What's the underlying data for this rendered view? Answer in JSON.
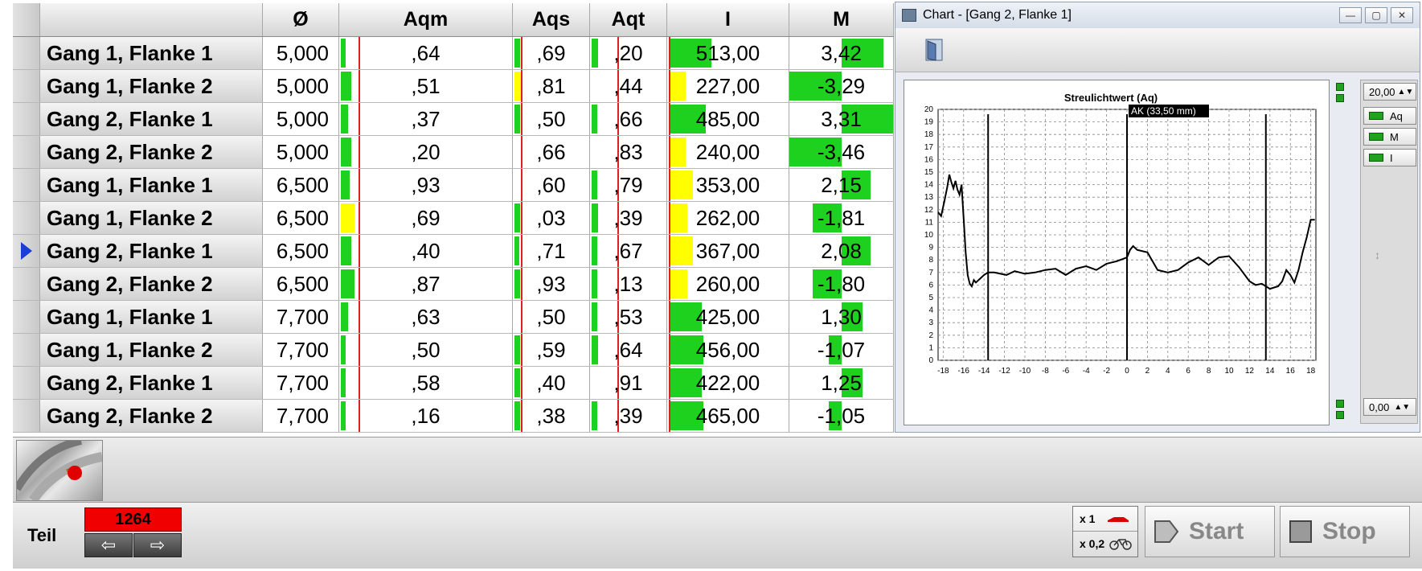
{
  "grid": {
    "headers": [
      "",
      "",
      "Ø",
      "Aqm",
      "Aqs",
      "Aqt",
      "I",
      "M"
    ],
    "rows": [
      {
        "name": "Gang 1, Flanke 1",
        "dia": "5,000",
        "aqm": ",64",
        "aqs": ",69",
        "aqt": ",20",
        "i": "513,00",
        "m": "3,42",
        "selected": false
      },
      {
        "name": "Gang 1, Flanke 2",
        "dia": "5,000",
        "aqm": ",51",
        "aqs": ",81",
        "aqt": ",44",
        "i": "227,00",
        "m": "-3,29",
        "selected": false
      },
      {
        "name": "Gang 2, Flanke 1",
        "dia": "5,000",
        "aqm": ",37",
        "aqs": ",50",
        "aqt": ",66",
        "i": "485,00",
        "m": "3,31",
        "selected": false
      },
      {
        "name": "Gang 2, Flanke 2",
        "dia": "5,000",
        "aqm": ",20",
        "aqs": ",66",
        "aqt": ",83",
        "i": "240,00",
        "m": "-3,46",
        "selected": false
      },
      {
        "name": "Gang 1, Flanke 1",
        "dia": "6,500",
        "aqm": ",93",
        "aqs": ",60",
        "aqt": ",79",
        "i": "353,00",
        "m": "2,15",
        "selected": false
      },
      {
        "name": "Gang 1, Flanke 2",
        "dia": "6,500",
        "aqm": ",69",
        "aqs": ",03",
        "aqt": ",39",
        "i": "262,00",
        "m": "-1,81",
        "selected": false
      },
      {
        "name": "Gang 2, Flanke 1",
        "dia": "6,500",
        "aqm": ",40",
        "aqs": ",71",
        "aqt": ",67",
        "i": "367,00",
        "m": "2,08",
        "selected": true
      },
      {
        "name": "Gang 2, Flanke 2",
        "dia": "6,500",
        "aqm": ",87",
        "aqs": ",93",
        "aqt": ",13",
        "i": "260,00",
        "m": "-1,80",
        "selected": false
      },
      {
        "name": "Gang 1, Flanke 1",
        "dia": "7,700",
        "aqm": ",63",
        "aqs": ",50",
        "aqt": ",53",
        "i": "425,00",
        "m": "1,30",
        "selected": false
      },
      {
        "name": "Gang 1, Flanke 2",
        "dia": "7,700",
        "aqm": ",50",
        "aqs": ",59",
        "aqt": ",64",
        "i": "456,00",
        "m": "-1,07",
        "selected": false
      },
      {
        "name": "Gang 2, Flanke 1",
        "dia": "7,700",
        "aqm": ",58",
        "aqs": ",40",
        "aqt": ",91",
        "i": "422,00",
        "m": "1,25",
        "selected": false
      },
      {
        "name": "Gang 2, Flanke 2",
        "dia": "7,700",
        "aqm": ",16",
        "aqs": ",38",
        "aqt": ",39",
        "i": "465,00",
        "m": "-1,05",
        "selected": false
      }
    ],
    "bar_levels": [
      {
        "aqm": 0.03,
        "aqs": 0.07,
        "aqt": 0.08,
        "i": 0.35,
        "m": 0.4,
        "i_color": "green"
      },
      {
        "aqm": 0.06,
        "aqs": 0.08,
        "aqt": 0.0,
        "i": 0.14,
        "m": 0.8,
        "i_color": "yellow"
      },
      {
        "aqm": 0.04,
        "aqs": 0.07,
        "aqt": 0.07,
        "i": 0.3,
        "m": 0.8,
        "i_color": "green"
      },
      {
        "aqm": 0.06,
        "aqs": 0.0,
        "aqt": 0.0,
        "i": 0.14,
        "m": 0.84,
        "i_color": "yellow"
      },
      {
        "aqm": 0.05,
        "aqs": 0.0,
        "aqt": 0.07,
        "i": 0.2,
        "m": 0.28,
        "i_color": "yellow"
      },
      {
        "aqm": 0.08,
        "aqs": 0.07,
        "aqt": 0.08,
        "i": 0.15,
        "m": 0.28,
        "i_color": "yellow"
      },
      {
        "aqm": 0.06,
        "aqs": 0.06,
        "aqt": 0.07,
        "i": 0.2,
        "m": 0.28,
        "i_color": "yellow"
      },
      {
        "aqm": 0.08,
        "aqs": 0.07,
        "aqt": 0.07,
        "i": 0.15,
        "m": 0.28,
        "i_color": "yellow"
      },
      {
        "aqm": 0.04,
        "aqs": 0.0,
        "aqt": 0.07,
        "i": 0.27,
        "m": 0.2,
        "i_color": "green"
      },
      {
        "aqm": 0.03,
        "aqs": 0.07,
        "aqt": 0.08,
        "i": 0.28,
        "m": 0.12,
        "i_color": "green"
      },
      {
        "aqm": 0.03,
        "aqs": 0.07,
        "aqt": 0.0,
        "i": 0.27,
        "m": 0.2,
        "i_color": "green"
      },
      {
        "aqm": 0.03,
        "aqs": 0.07,
        "aqt": 0.07,
        "i": 0.28,
        "m": 0.12,
        "i_color": "green"
      }
    ],
    "aqm_bar_color": "#1fd11f"
  },
  "chart_window": {
    "title": "Chart - [Gang 2, Flanke 1]",
    "side": {
      "top_value": "20,00",
      "bottom_value": "0,00",
      "legend": [
        "Aq",
        "M",
        "I"
      ]
    }
  },
  "chart_data": {
    "type": "line",
    "title": "Streulichtwert (Aq)",
    "annotation": "AK (33,50 mm)",
    "xlim": [
      -18.5,
      18.5
    ],
    "ylim": [
      0,
      20
    ],
    "x_ticks": [
      -18,
      -16,
      -14,
      -12,
      -10,
      -8,
      -6,
      -4,
      -2,
      0,
      2,
      4,
      6,
      8,
      10,
      12,
      14,
      16,
      18
    ],
    "y_ticks": [
      0,
      1,
      2,
      3,
      4,
      5,
      6,
      7,
      8,
      9,
      10,
      11,
      12,
      13,
      14,
      15,
      16,
      17,
      18,
      19,
      20
    ],
    "grid": true,
    "markers_x": [
      -13.6,
      0,
      13.6
    ],
    "series": [
      {
        "x": [
          -18.5,
          -18.2,
          -17.9,
          -17.6,
          -17.4,
          -17.2,
          -17.0,
          -16.8,
          -16.6,
          -16.4,
          -16.2,
          -16.0,
          -15.8,
          -15.6,
          -15.4,
          -15.2,
          -15.0,
          -14.8,
          -14.4,
          -14.0,
          -13.6,
          -13.0,
          -12.4,
          -11.8,
          -11.0,
          -10.0,
          -9.0,
          -8.0,
          -7.0,
          -6.0,
          -5.0,
          -4.0,
          -3.0,
          -2.0,
          -1.0,
          0.0,
          0.3,
          0.6,
          1.0,
          2.0,
          3.0,
          4.0,
          5.0,
          6.0,
          7.0,
          8.0,
          9.0,
          10.0,
          11.0,
          12.0,
          12.6,
          13.2,
          14.0,
          14.8,
          15.2,
          15.6,
          16.0,
          16.4,
          16.8,
          17.2,
          17.6,
          18.0,
          18.4
        ],
        "y": [
          11.8,
          11.5,
          12.6,
          13.8,
          14.8,
          14.2,
          13.7,
          14.3,
          13.6,
          13.2,
          14.0,
          11.3,
          8.6,
          6.8,
          6.1,
          5.9,
          6.4,
          6.2,
          6.5,
          6.8,
          7.0,
          7.0,
          6.9,
          6.8,
          7.1,
          6.9,
          7.0,
          7.2,
          7.3,
          6.8,
          7.3,
          7.5,
          7.2,
          7.7,
          7.9,
          8.2,
          8.8,
          9.1,
          8.8,
          8.6,
          7.2,
          7.0,
          7.2,
          7.8,
          8.2,
          7.6,
          8.2,
          8.3,
          7.4,
          6.3,
          6.0,
          6.1,
          5.7,
          5.9,
          6.3,
          7.2,
          6.8,
          6.2,
          7.2,
          8.6,
          9.8,
          11.2,
          11.2
        ]
      }
    ]
  },
  "image_panel": {
    "thumbnail": "gear-thumbnail"
  },
  "bottom_bar": {
    "teil_label": "Teil",
    "counter": "1264",
    "prev_icon": "arrow-left-icon",
    "next_icon": "arrow-right-icon",
    "speed_fast": "x 1",
    "speed_slow": "x 0,2",
    "start_label": "Start",
    "stop_label": "Stop"
  }
}
